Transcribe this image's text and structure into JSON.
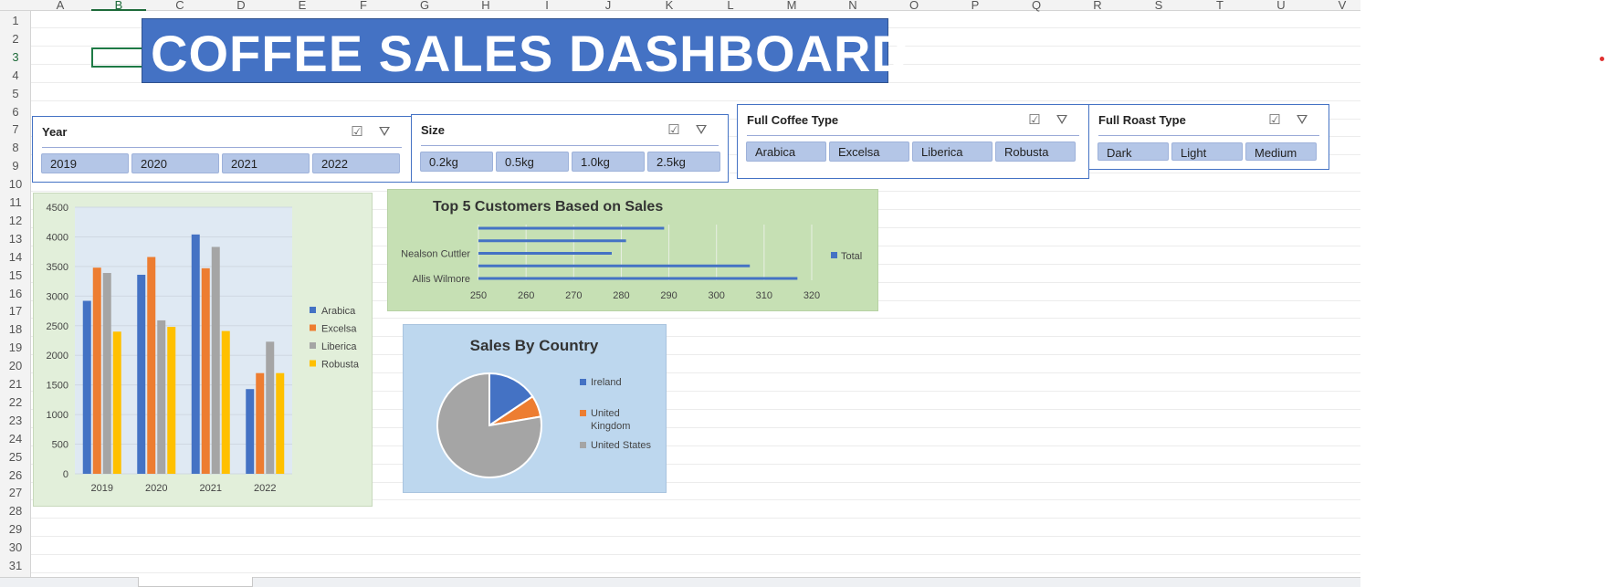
{
  "columns": [
    "A",
    "B",
    "C",
    "D",
    "E",
    "F",
    "G",
    "H",
    "I",
    "J",
    "K",
    "L",
    "M",
    "N",
    "O",
    "P",
    "Q",
    "R",
    "S",
    "T",
    "U",
    "V"
  ],
  "rows": [
    "1",
    "2",
    "3",
    "4",
    "5",
    "6",
    "7",
    "8",
    "9",
    "10",
    "11",
    "12",
    "13",
    "14",
    "15",
    "16",
    "17",
    "18",
    "19",
    "20",
    "21",
    "22",
    "23",
    "24",
    "25",
    "26",
    "27",
    "28",
    "29",
    "30",
    "31"
  ],
  "selected_column": "B",
  "selected_row": "3",
  "dashboard_title": "COFFEE SALES DASHBOARD",
  "slicers": {
    "year": {
      "title": "Year",
      "items": [
        "2019",
        "2020",
        "2021",
        "2022"
      ]
    },
    "size": {
      "title": "Size",
      "items": [
        "0.2kg",
        "0.5kg",
        "1.0kg",
        "2.5kg"
      ]
    },
    "coffee_type": {
      "title": "Full Coffee Type",
      "items": [
        "Arabica",
        "Excelsa",
        "Liberica",
        "Robusta"
      ]
    },
    "roast_type": {
      "title": "Full Roast Type",
      "items": [
        "Dark",
        "Light",
        "Medium"
      ]
    }
  },
  "icons": {
    "multi_select": "multi-select-icon",
    "clear_filter": "clear-filter-icon"
  },
  "colors": {
    "title_bg": "#4472c4",
    "slicer_item": "#b4c6e7",
    "arabica": "#4472c4",
    "excelsa": "#ed7d31",
    "liberica": "#a5a5a5",
    "robusta": "#ffc000",
    "bar_chart_bg": "#e2efda",
    "top5_bg": "#c6e0b4",
    "pie_bg": "#bdd7ee"
  },
  "chart_data": [
    {
      "type": "bar",
      "categories": [
        "2019",
        "2020",
        "2021",
        "2022"
      ],
      "series": [
        {
          "name": "Arabica",
          "values": [
            2920,
            3360,
            4040,
            1430
          ]
        },
        {
          "name": "Excelsa",
          "values": [
            3480,
            3660,
            3470,
            1700
          ]
        },
        {
          "name": "Liberica",
          "values": [
            3390,
            2590,
            3830,
            2230
          ]
        },
        {
          "name": "Robusta",
          "values": [
            2400,
            2480,
            2410,
            1700
          ]
        }
      ],
      "yticks": [
        "0",
        "500",
        "1000",
        "1500",
        "2000",
        "2500",
        "3000",
        "3500",
        "4000",
        "4500"
      ],
      "ylim": [
        0,
        4500
      ],
      "grid": true,
      "legend": "right"
    },
    {
      "type": "bar",
      "orientation": "horizontal",
      "title": "Top 5 Customers Based on Sales",
      "categories": [
        "Allis Wilmore",
        "",
        "Nealson Cuttler",
        "",
        ""
      ],
      "series": [
        {
          "name": "Total",
          "values": [
            317,
            307,
            278,
            281,
            289
          ]
        }
      ],
      "xticks": [
        "250",
        "260",
        "270",
        "280",
        "290",
        "300",
        "310",
        "320"
      ],
      "xlim": [
        250,
        320
      ],
      "legend": "right"
    },
    {
      "type": "pie",
      "title": "Sales By Country",
      "labels": [
        "Ireland",
        "United Kingdom",
        "United States"
      ],
      "values": [
        15.6,
        6.7,
        77.7
      ],
      "legend": "right"
    }
  ]
}
